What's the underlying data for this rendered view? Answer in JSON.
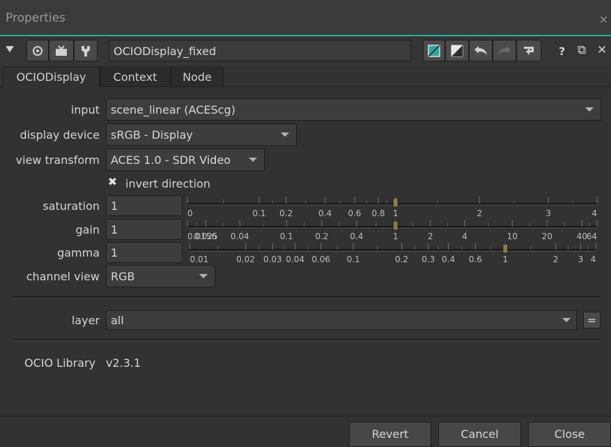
{
  "panel": {
    "title": "Properties",
    "close_glyph": "×"
  },
  "node": {
    "name": "OCIODisplay_fixed",
    "header_glyphs": {
      "help": "?",
      "float": "⧉",
      "close": "✕"
    }
  },
  "tabs": [
    {
      "label": "OCIODisplay",
      "active": true
    },
    {
      "label": "Context",
      "active": false
    },
    {
      "label": "Node",
      "active": false
    }
  ],
  "knobs": {
    "input": {
      "label": "input",
      "value": "scene_linear (ACEScg)"
    },
    "display_device": {
      "label": "display device",
      "value": "sRGB - Display"
    },
    "view_transform": {
      "label": "view transform",
      "value": "ACES 1.0 - SDR Video"
    },
    "invert_direction": {
      "label": "invert direction",
      "checked": true,
      "mark": "✖"
    },
    "saturation": {
      "label": "saturation",
      "value": "1",
      "ticks": [
        "0",
        "0.1",
        "0.2",
        "0.4",
        "0.6",
        "0.8",
        "1",
        "2",
        "3",
        "4"
      ]
    },
    "gain": {
      "label": "gain",
      "value": "1",
      "ticks": [
        "0.0156",
        "0.025",
        "0.04",
        "0.1",
        "0.2",
        "0.4",
        "1",
        "2",
        "4",
        "10",
        "20",
        "40",
        "64"
      ]
    },
    "gamma": {
      "label": "gamma",
      "value": "1",
      "ticks": [
        "0.01",
        "0.02",
        "0.03",
        "0.04",
        "0.06",
        "0.1",
        "0.2",
        "0.3",
        "0.4",
        "0.6",
        "1",
        "2",
        "3",
        "4"
      ]
    },
    "channel_view": {
      "label": "channel view",
      "value": "RGB"
    },
    "layer": {
      "label": "layer",
      "value": "all",
      "link_glyph": "="
    }
  },
  "library": {
    "label": "OCIO Library",
    "version": "v2.3.1"
  },
  "footer": {
    "revert": "Revert",
    "cancel": "Cancel",
    "close": "Close"
  }
}
